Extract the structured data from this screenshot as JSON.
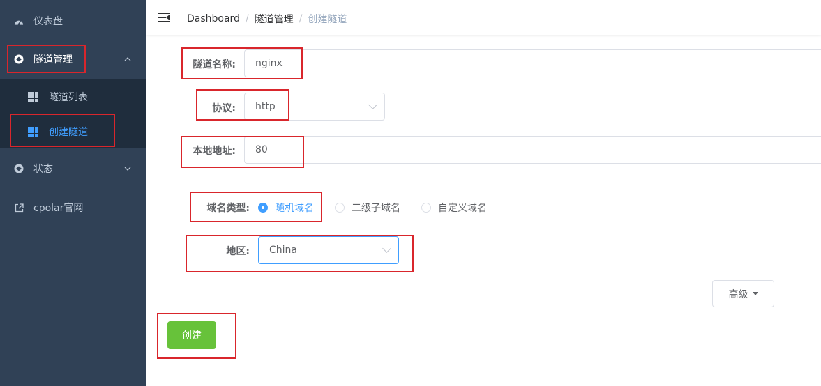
{
  "sidebar": {
    "items": [
      {
        "label": "仪表盘",
        "icon": "dashboard-icon"
      },
      {
        "label": "隧道管理",
        "icon": "tunnel-management-icon",
        "expanded": true
      },
      {
        "label": "状态",
        "icon": "status-icon"
      },
      {
        "label": "cpolar官网",
        "icon": "external-link-icon"
      }
    ],
    "submenu": [
      {
        "label": "隧道列表",
        "icon": "grid-icon",
        "active": false
      },
      {
        "label": "创建隧道",
        "icon": "grid-icon",
        "active": true
      }
    ]
  },
  "header": {
    "breadcrumb": [
      "Dashboard",
      "隧道管理",
      "创建隧道"
    ],
    "separator": "/"
  },
  "form": {
    "tunnel_name": {
      "label": "隧道名称:",
      "value": "nginx"
    },
    "protocol": {
      "label": "协议:",
      "value": "http"
    },
    "local_address": {
      "label": "本地地址:",
      "value": "80"
    },
    "domain_type": {
      "label": "域名类型:",
      "options": [
        "随机域名",
        "二级子域名",
        "自定义域名"
      ],
      "selected": "随机域名"
    },
    "region": {
      "label": "地区:",
      "value": "China"
    },
    "advanced_label": "高级",
    "create_label": "创建"
  },
  "colors": {
    "sidebar_bg": "#304156",
    "submenu_bg": "#1f2d3d",
    "active": "#409eff",
    "create_button": "#67c23a",
    "highlight_box": "#d9262c"
  }
}
